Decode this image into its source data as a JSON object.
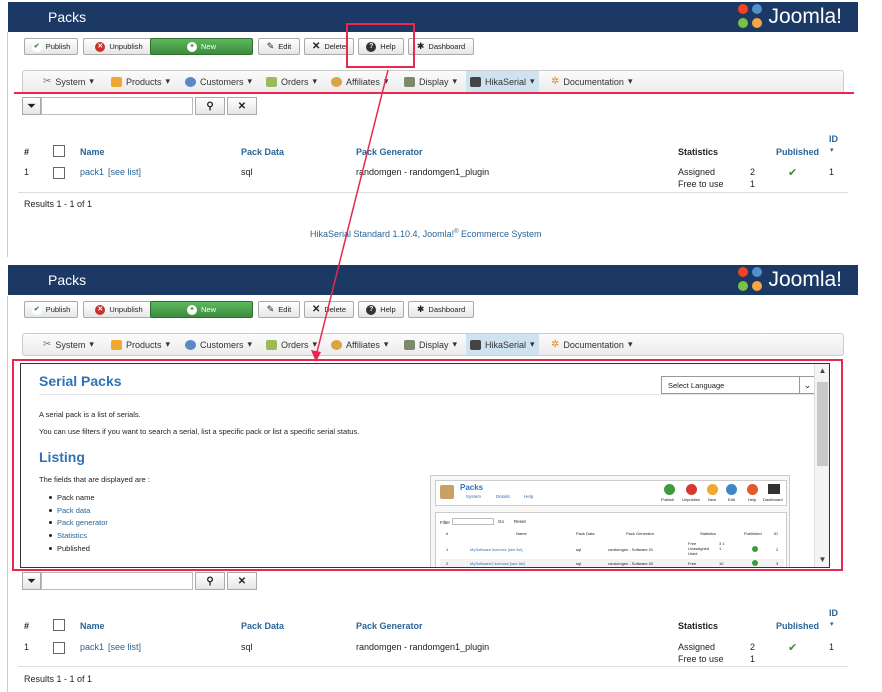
{
  "top": {
    "title": "Packs",
    "joomla_text": "Joomla!",
    "toolbar": {
      "publish": "Publish",
      "unpublish": "Unpublish",
      "new": "New",
      "edit": "Edit",
      "delete": "Delete",
      "help": "Help",
      "dashboard": "Dashboard"
    },
    "menu": [
      "System",
      "Products",
      "Customers",
      "Orders",
      "Affiliates",
      "Display",
      "HikaSerial",
      "Documentation"
    ],
    "columns": {
      "hash": "#",
      "name": "Name",
      "pack_data": "Pack Data",
      "pack_generator": "Pack Generator",
      "statistics": "Statistics",
      "published": "Published",
      "id": "ID"
    },
    "row": {
      "num": "1",
      "name": "pack1",
      "see_list": "[see list]",
      "pack_data": "sql",
      "pack_generator": "randomgen - randomgen1_plugin",
      "stat1_label": "Assigned",
      "stat1_value": "2",
      "stat2_label": "Free to use",
      "stat2_value": "1",
      "id": "1"
    },
    "results": "Results 1 - 1 of 1",
    "footer_pre": "HikaSerial Standard 1.10.4, Joomla!",
    "footer_reg": "®",
    "footer_post": " Ecommerce System"
  },
  "help_panel": {
    "title": "Serial Packs",
    "language_select": "Select Language",
    "para1": "A serial pack is a list of serials.",
    "para2": "You can use filters if you want to search a serial, list a specific pack or list a specific serial status.",
    "listing_title": "Listing",
    "fields_intro": "The fields that are displayed are :",
    "fields": [
      {
        "label": "Pack name",
        "is_link": false
      },
      {
        "label": "Pack data",
        "is_link": true
      },
      {
        "label": "Pack generator",
        "is_link": true
      },
      {
        "label": "Statistics",
        "is_link": true
      },
      {
        "label": "Published",
        "is_link": false
      }
    ],
    "thumb": {
      "title": "Packs",
      "sub": [
        "System",
        "Details",
        "Help"
      ],
      "btns": [
        "Publish",
        "Unpublish",
        "New",
        "Edit",
        "Help",
        "Dashboard"
      ],
      "filter": "Filter",
      "go": "Go",
      "reset": "Reset",
      "cols": [
        "#",
        "Name",
        "Pack Data",
        "Pack Generator",
        "Statistics",
        "Published",
        "ID"
      ],
      "row1": [
        "1",
        "MySoftware licences [see list]",
        "sql",
        "randomgen - Software 01",
        "Free Unassigned Used",
        "3 1 1",
        "2"
      ],
      "row2": [
        "2",
        "MySoftware2 licences [see list]",
        "sql",
        "randomgen - Software 02",
        "Free",
        "10",
        "3"
      ]
    }
  },
  "colors": {
    "header": "#1c3966",
    "accent": "#2e72b8",
    "annotation": "#e8294d"
  }
}
